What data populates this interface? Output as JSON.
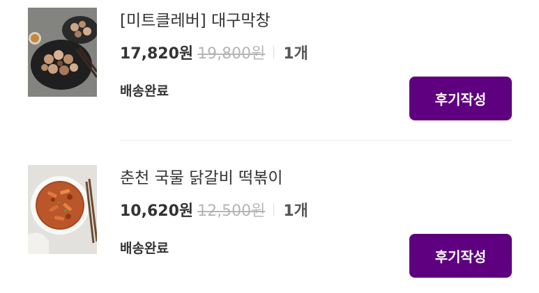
{
  "orders": [
    {
      "title": "[미트클레버] 대구막창",
      "image": "meat-dish-image",
      "price": "17,820원",
      "original_price": "19,800원",
      "quantity": "1개",
      "status": "배송완료",
      "review_button": "후기작성"
    },
    {
      "title": "춘천 국물 닭갈비 떡볶이",
      "image": "tteokbokki-dish-image",
      "price": "10,620원",
      "original_price": "12,500원",
      "quantity": "1개",
      "status": "배송완료",
      "review_button": "후기작성"
    }
  ],
  "colors": {
    "accent": "#5f0080",
    "strikethrough": "#b5b5b5"
  }
}
